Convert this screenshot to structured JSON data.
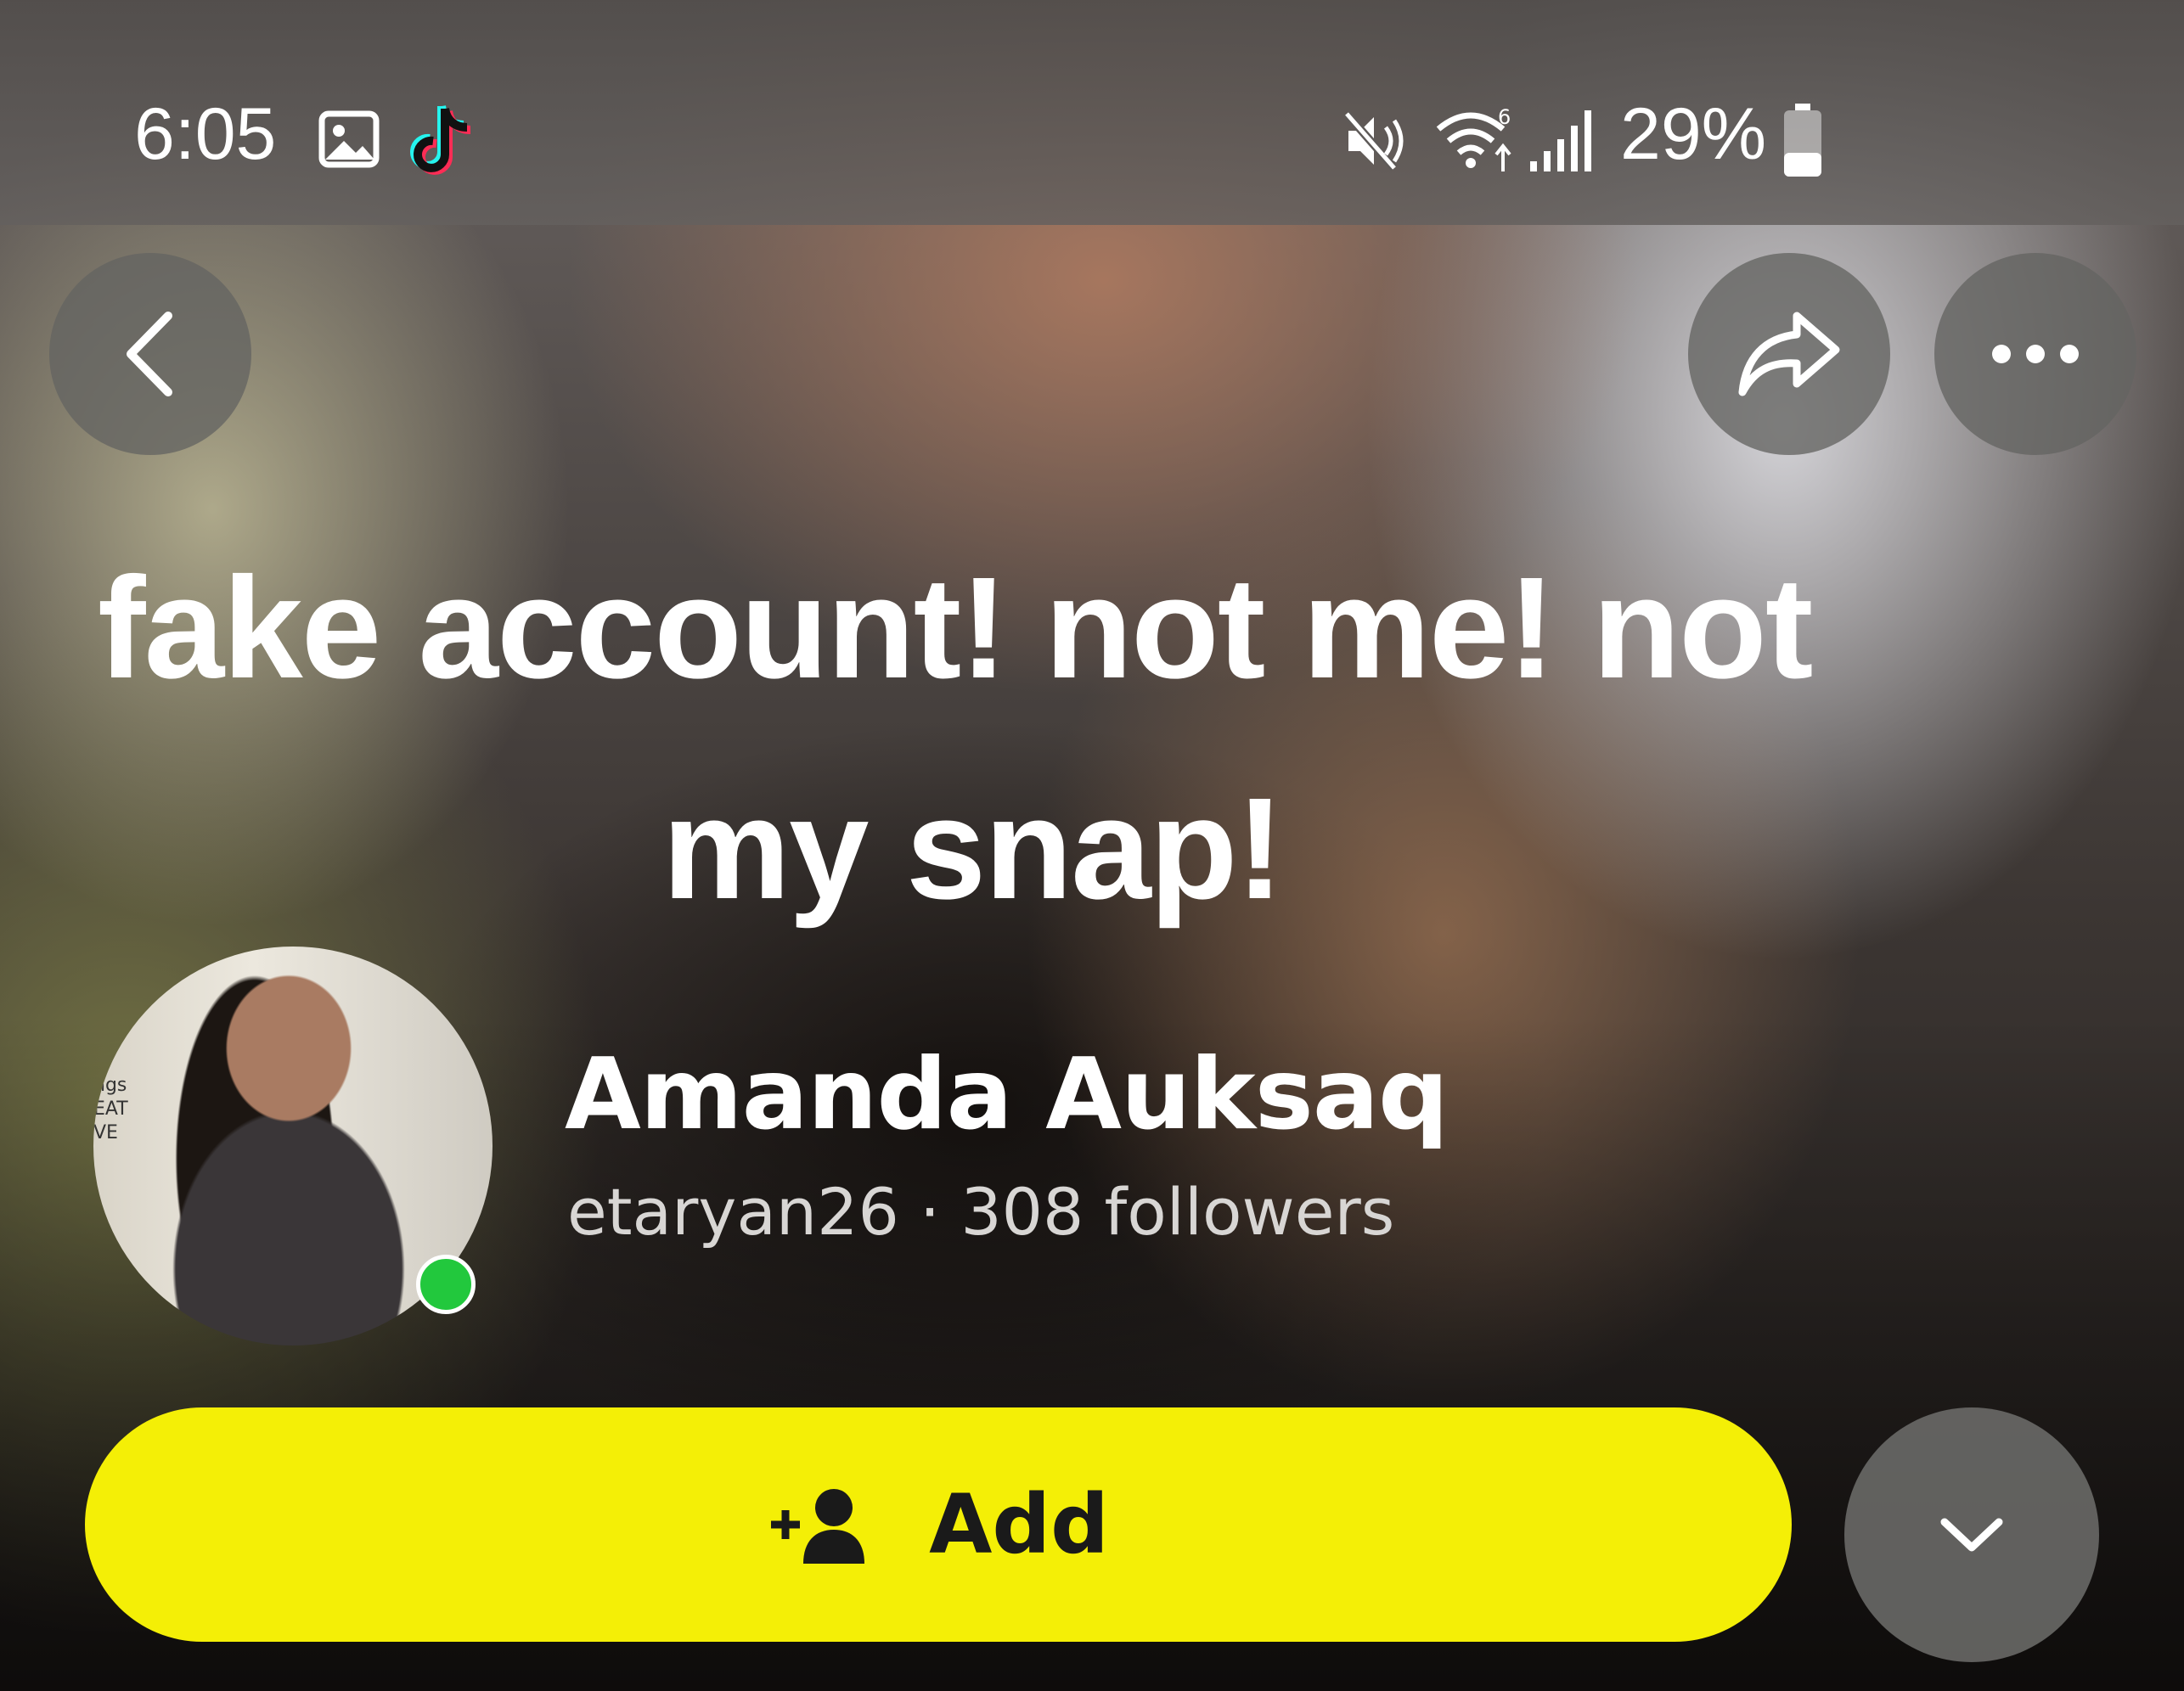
{
  "status_bar": {
    "time": "6:05",
    "icons": [
      "gallery-icon",
      "tiktok-icon",
      "mute-icon",
      "wifi-icon",
      "signal-icon",
      "battery-icon"
    ],
    "battery_percent": "29%"
  },
  "toolbar": {
    "back_icon": "chevron-left-icon",
    "share_icon": "share-arrow-icon",
    "more_icon": "more-dots-icon"
  },
  "profile": {
    "bio_line1": "fake account! not me! not",
    "bio_line2": "my snap!",
    "name": "Amanda Auksaq",
    "username": "etaryan26",
    "separator": "·",
    "followers": "308 followers",
    "online": true,
    "avatar_sign": [
      "ngs",
      "EAT",
      "VE"
    ]
  },
  "actions": {
    "add_label": "Add",
    "add_icon": "add-friend-icon",
    "expand_icon": "chevron-down-icon"
  },
  "colors": {
    "add_button": "#f4ef06",
    "online_dot": "#22c83d"
  }
}
